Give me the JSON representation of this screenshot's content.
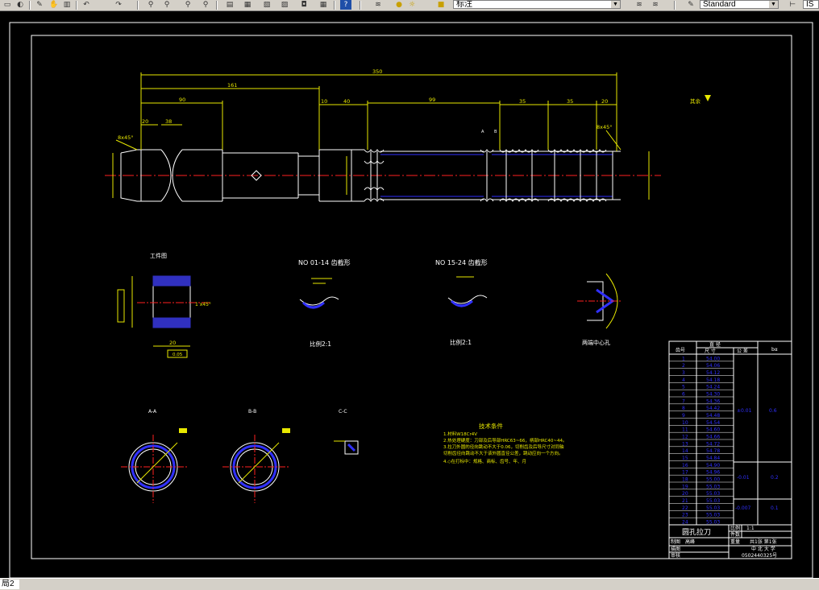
{
  "toolbar": {
    "layer_combo": "标注",
    "text_style_combo": "Standard",
    "right_combo": "IS"
  },
  "layout_tab": "局2",
  "drawing": {
    "main_dims": {
      "overall": "350",
      "d161": "161",
      "d90": "90",
      "d20a": "20",
      "d38": "38",
      "d10": "10",
      "d40": "40",
      "d99": "99",
      "d35a": "35",
      "d35b": "35",
      "d20b": "20",
      "chamfer_left": "8x45°",
      "chamfer_right": "8x45°",
      "roughness_label": "其余"
    },
    "workpiece": {
      "title": "工件图",
      "dim_bottom": "20",
      "tolerance_box": "0.05",
      "chamfer": "1 x45°"
    },
    "tooth_a": {
      "title": "NO  01-14  齿截形",
      "scale": "比例2:1"
    },
    "tooth_b": {
      "title": "NO  15-24  齿截形",
      "scale": "比例2:1"
    },
    "center_hole": {
      "label": "两端中心孔"
    },
    "sections": {
      "aa": "A-A",
      "bb": "B-B",
      "cc": "C-C"
    },
    "tech": {
      "title": "技术条件",
      "lines": [
        "1.材料W18Cr4V",
        "2.热处理硬度：刀部及后导部HRC63~66，柄部HRC40~44。",
        "3.拉刀外圆的径向跳动不大于0.06，切削齿及后导尺寸对同轴",
        "  切削齿径向跳动不大于该外圆直径公差，跳动应向一个方向。",
        "4.◇在打标中：规格、商标、齿号、年、月"
      ]
    },
    "table": {
      "headers": [
        "齿号",
        "直    径",
        "尺  寸",
        "公  差",
        "bα"
      ],
      "rows": [
        [
          "1",
          "54.00"
        ],
        [
          "2",
          "54.06"
        ],
        [
          "3",
          "54.12"
        ],
        [
          "4",
          "54.18"
        ],
        [
          "5",
          "54.24"
        ],
        [
          "6",
          "54.30"
        ],
        [
          "7",
          "54.36"
        ],
        [
          "8",
          "54.42"
        ],
        [
          "9",
          "54.48"
        ],
        [
          "10",
          "54.54"
        ],
        [
          "11",
          "54.60"
        ],
        [
          "12",
          "54.66"
        ],
        [
          "13",
          "54.72"
        ],
        [
          "14",
          "54.78"
        ],
        [
          "15",
          "54.84"
        ],
        [
          "16",
          "54.90"
        ],
        [
          "17",
          "54.96"
        ],
        [
          "18",
          "55.00"
        ],
        [
          "19",
          "55.03"
        ],
        [
          "20",
          "55.03"
        ],
        [
          "21",
          "55.03"
        ],
        [
          "22",
          "55.03"
        ],
        [
          "23",
          "55.03"
        ],
        [
          "24",
          "55.03"
        ]
      ],
      "tol1": "±0.01",
      "tol2": "-0.01",
      "tol3": "-0.007",
      "b1": "0.6",
      "b2": "0.2",
      "b3": "0.1"
    },
    "title_block": {
      "name": "圆孔拉刀",
      "scale_label": "比例",
      "scale_value": "1:1",
      "qty_label": "件数",
      "drawn_label": "制图",
      "drawn_by": "高峰",
      "weight_label": "重量",
      "sheet": "共1张 第1张",
      "school": "中  北  大  学",
      "check_label": "描图",
      "approve_label": "审核",
      "student_no": "0502440325号"
    }
  }
}
